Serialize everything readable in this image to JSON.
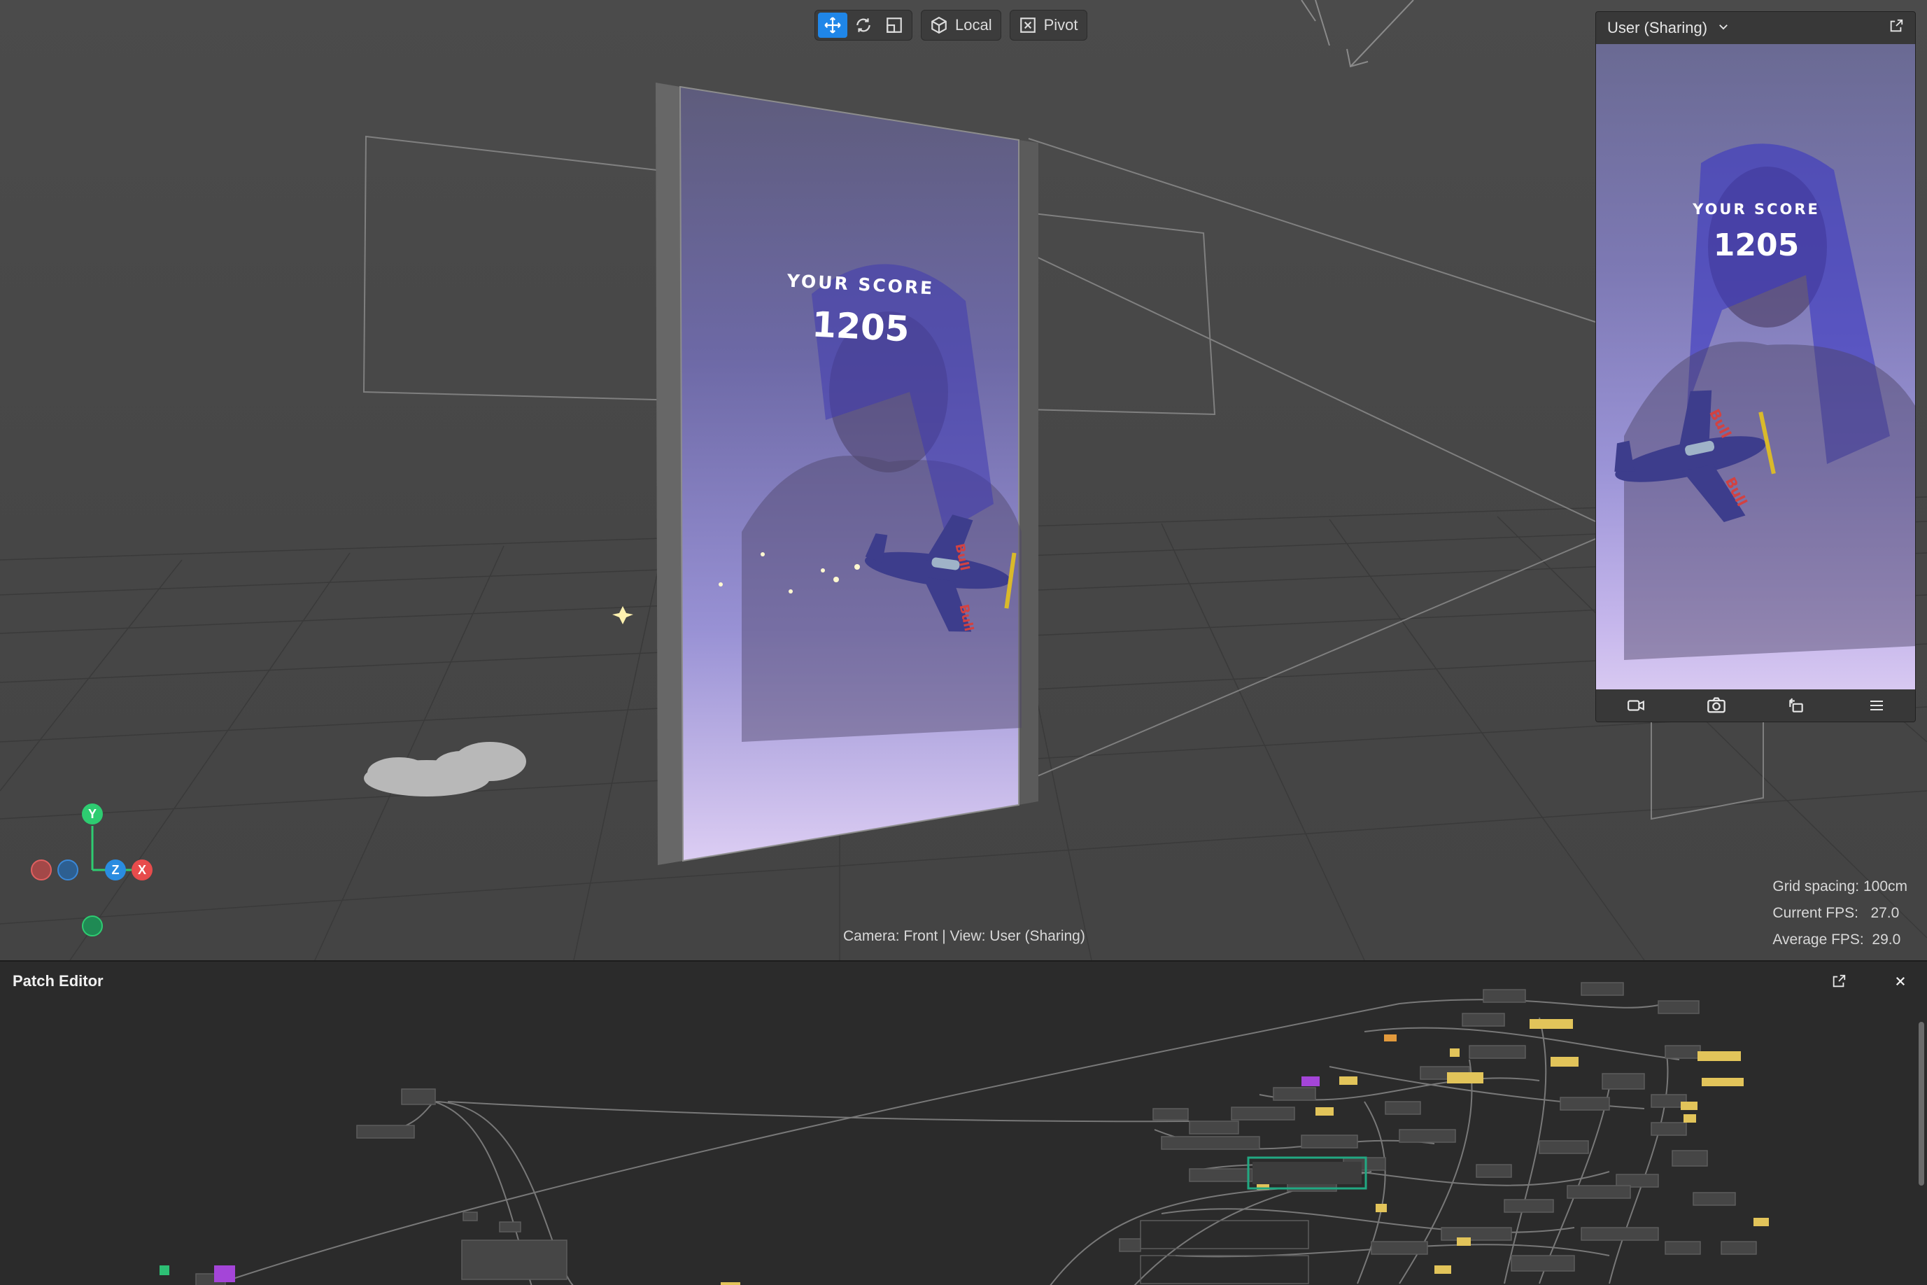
{
  "toolbar": {
    "move_tool": "move-tool",
    "rotate_tool": "rotate-tool",
    "scale_tool": "scale-tool",
    "space_label": "Local",
    "pivot_label": "Pivot"
  },
  "scene": {
    "score_label": "YOUR SCORE",
    "score_value": "1205",
    "camera_info": "Camera: Front | View: User (Sharing)",
    "grid_spacing": "Grid spacing: 100cm",
    "current_fps": "Current FPS:   27.0",
    "average_fps": "Average FPS:  29.0",
    "axis": {
      "y": "Y",
      "z": "Z",
      "x": "X"
    }
  },
  "preview": {
    "title": "User (Sharing)",
    "score_label": "YOUR SCORE",
    "score_value": "1205",
    "footer_icons": [
      "video-camera-icon",
      "screenshot-icon",
      "rotate-device-icon",
      "menu-icon"
    ]
  },
  "patch_editor": {
    "title": "Patch Editor"
  },
  "colors": {
    "accent": "#1f86e8",
    "axis_y": "#2ecc71",
    "axis_x": "#e74c4c",
    "axis_z": "#2a8ce0",
    "patch_yellow": "#e2c45a",
    "patch_purple": "#a445d8",
    "patch_green": "#2dbf74",
    "patch_orange": "#e39a3c",
    "selection_green": "#21a882"
  }
}
